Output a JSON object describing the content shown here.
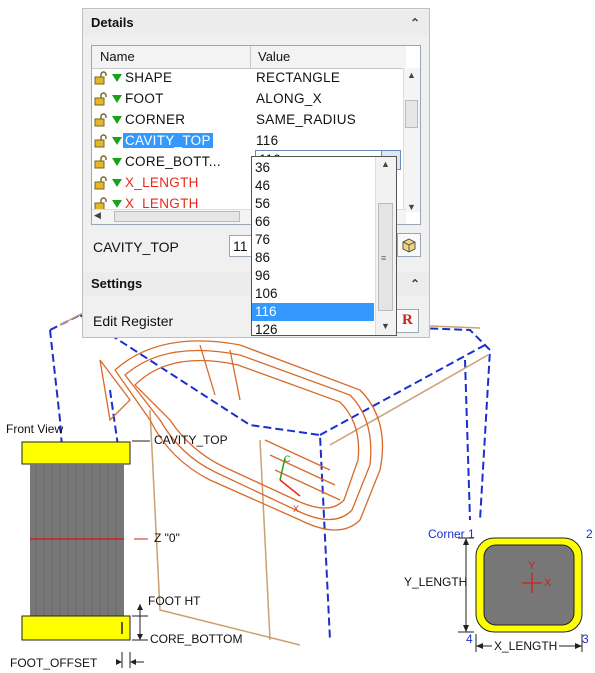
{
  "details": {
    "title": "Details",
    "columns": {
      "name": "Name",
      "value": "Value"
    },
    "rows": [
      {
        "name": "SHAPE",
        "value": "RECTANGLE",
        "name_color": "#111111"
      },
      {
        "name": "FOOT",
        "value": "ALONG_X",
        "name_color": "#111111"
      },
      {
        "name": "CORNER",
        "value": "SAME_RADIUS",
        "name_color": "#111111"
      },
      {
        "name": "CAVITY_TOP",
        "value": "116",
        "name_color": "#ffffff"
      },
      {
        "name": "CORE_BOTT...",
        "value": "",
        "name_color": "#111111"
      },
      {
        "name": "X_LENGTH",
        "value": "",
        "name_color": "#e8291c"
      },
      {
        "name": "X_LENGTH",
        "value": "",
        "name_color": "#e8291c"
      }
    ],
    "combo_value": "116",
    "field_label": "CAVITY_TOP",
    "field_value": "11"
  },
  "settings": {
    "title": "Settings",
    "edit_register": "Edit Register"
  },
  "dropdown": {
    "options": [
      "36",
      "46",
      "56",
      "66",
      "76",
      "86",
      "96",
      "106",
      "116",
      "126"
    ],
    "selected": "116"
  },
  "front_view": {
    "title": "Front View",
    "labels": {
      "cavity_top": "CAVITY_TOP",
      "z_zero": "Z \"0\"",
      "foot_ht": "FOOT HT",
      "core_bottom": "CORE_BOTTOM",
      "foot_offset": "FOOT_OFFSET"
    }
  },
  "corner_view": {
    "corner1": "Corner 1",
    "corner2": "2",
    "corner3": "3",
    "corner4": "4",
    "y_length": "Y_LENGTH",
    "x_length": "X_LENGTH",
    "axis_y": "Y",
    "axis_x": "X"
  },
  "colors": {
    "accent": "#3399ff",
    "model_orange": "#d96a2a",
    "model_blue": "#1a2fd0",
    "yellow": "#ffff00",
    "red_label": "#e8291c"
  }
}
